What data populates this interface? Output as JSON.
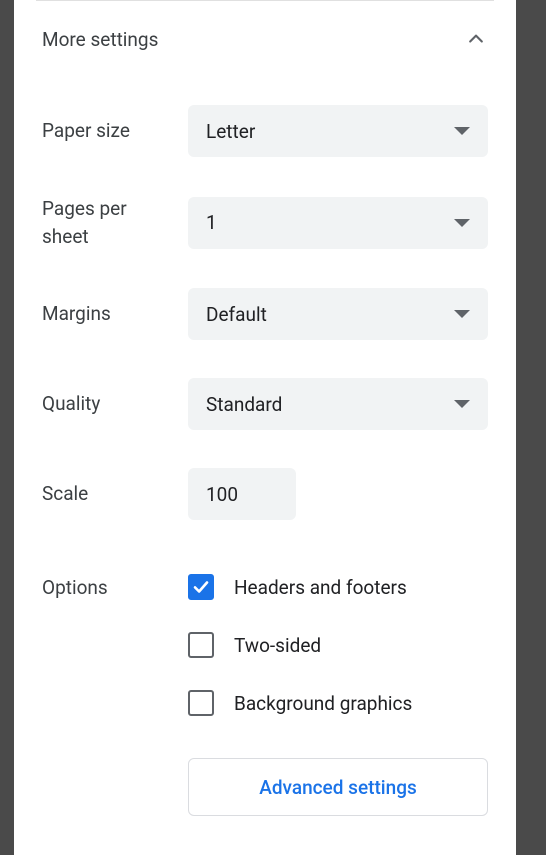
{
  "section": {
    "title": "More settings"
  },
  "paperSize": {
    "label": "Paper size",
    "value": "Letter"
  },
  "pagesPerSheet": {
    "label": "Pages per sheet",
    "value": "1"
  },
  "margins": {
    "label": "Margins",
    "value": "Default"
  },
  "quality": {
    "label": "Quality",
    "value": "Standard"
  },
  "scale": {
    "label": "Scale",
    "value": "100"
  },
  "options": {
    "label": "Options",
    "headersFooters": {
      "label": "Headers and footers",
      "checked": true
    },
    "twoSided": {
      "label": "Two-sided",
      "checked": false
    },
    "backgroundGraphics": {
      "label": "Background graphics",
      "checked": false
    }
  },
  "advanced": {
    "label": "Advanced settings"
  }
}
